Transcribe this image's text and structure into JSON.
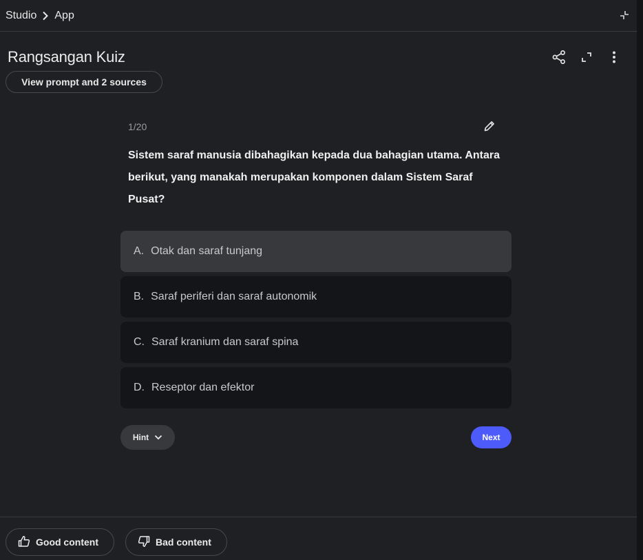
{
  "breadcrumb": {
    "items": [
      "Studio",
      "App"
    ],
    "separator_icon": "chevron-right-icon"
  },
  "header": {
    "title": "Rangsangan Kuiz",
    "view_prompt_label": "View prompt and 2 sources",
    "actions": [
      "share-icon",
      "expand-icon",
      "more-vert-icon"
    ]
  },
  "quiz": {
    "counter": "1/20",
    "question": "Sistem saraf manusia dibahagikan kepada dua bahagian utama. Antara berikut, yang manakah merupakan komponen dalam Sistem Saraf Pusat?",
    "options": [
      {
        "letter": "A.",
        "text": "Otak dan saraf tunjang"
      },
      {
        "letter": "B.",
        "text": "Saraf periferi dan saraf autonomik"
      },
      {
        "letter": "C.",
        "text": "Saraf kranium dan saraf spina"
      },
      {
        "letter": "D.",
        "text": "Reseptor dan efektor"
      }
    ],
    "hint_label": "Hint",
    "next_label": "Next"
  },
  "footer": {
    "good_label": "Good content",
    "bad_label": "Bad content"
  },
  "colors": {
    "background": "#1f2023",
    "option_bg": "#141518",
    "option_highlight": "#38393c",
    "accent": "#4d5bfa"
  }
}
